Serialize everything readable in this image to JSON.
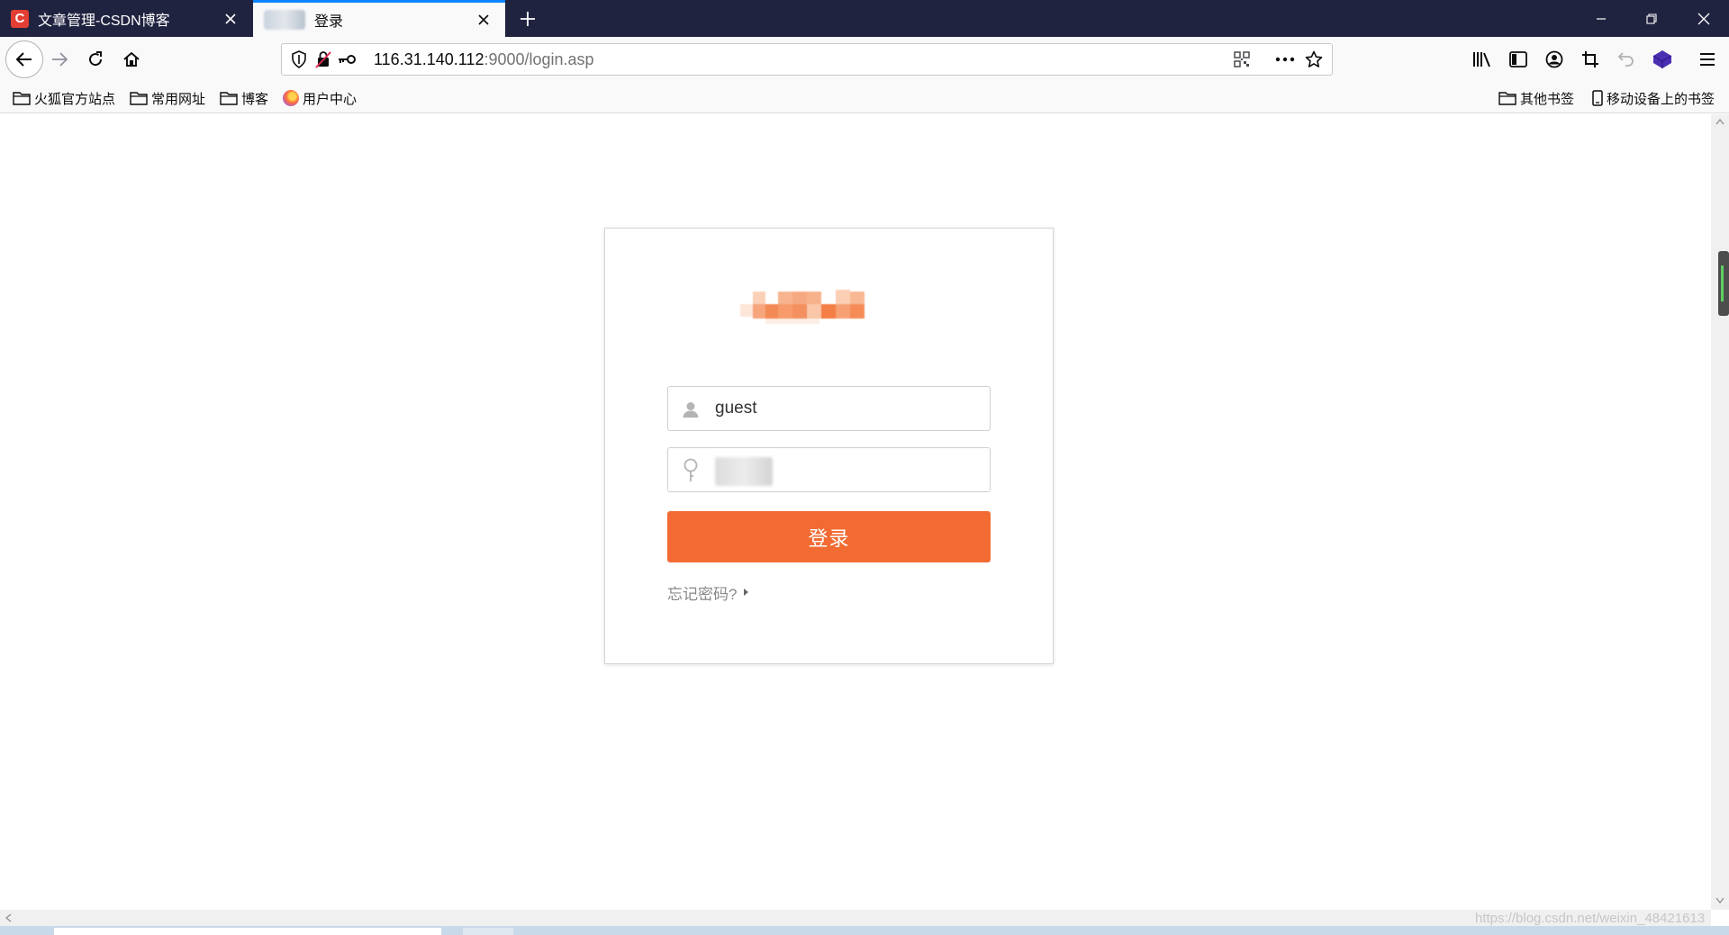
{
  "tabs": [
    {
      "title": "文章管理-CSDN博客",
      "favicon": "csdn-icon",
      "active": false
    },
    {
      "title": "登录",
      "favicon": "blurred-icon",
      "active": true
    }
  ],
  "window_controls": [
    "minimize-icon",
    "restore-icon",
    "close-icon"
  ],
  "urlbar": {
    "host": "116.31.140.112",
    "rest": ":9000/login.asp"
  },
  "bookmarks_left": [
    {
      "label": "火狐官方站点",
      "icon": "folder-icon"
    },
    {
      "label": "常用网址",
      "icon": "folder-icon"
    },
    {
      "label": "博客",
      "icon": "folder-icon"
    },
    {
      "label": "用户中心",
      "icon": "globe-icon"
    }
  ],
  "bookmarks_right": [
    {
      "label": "其他书签",
      "icon": "folder-icon"
    },
    {
      "label": "移动设备上的书签",
      "icon": "mobile-icon"
    }
  ],
  "login": {
    "username_value": "guest",
    "login_button": "登录",
    "forgot_password": "忘记密码?"
  },
  "colors": {
    "accent": "#f26b33",
    "tabbar": "#202340",
    "tab_highlight": "#0a84ff"
  },
  "watermark": "https://blog.csdn.net/weixin_48421613"
}
